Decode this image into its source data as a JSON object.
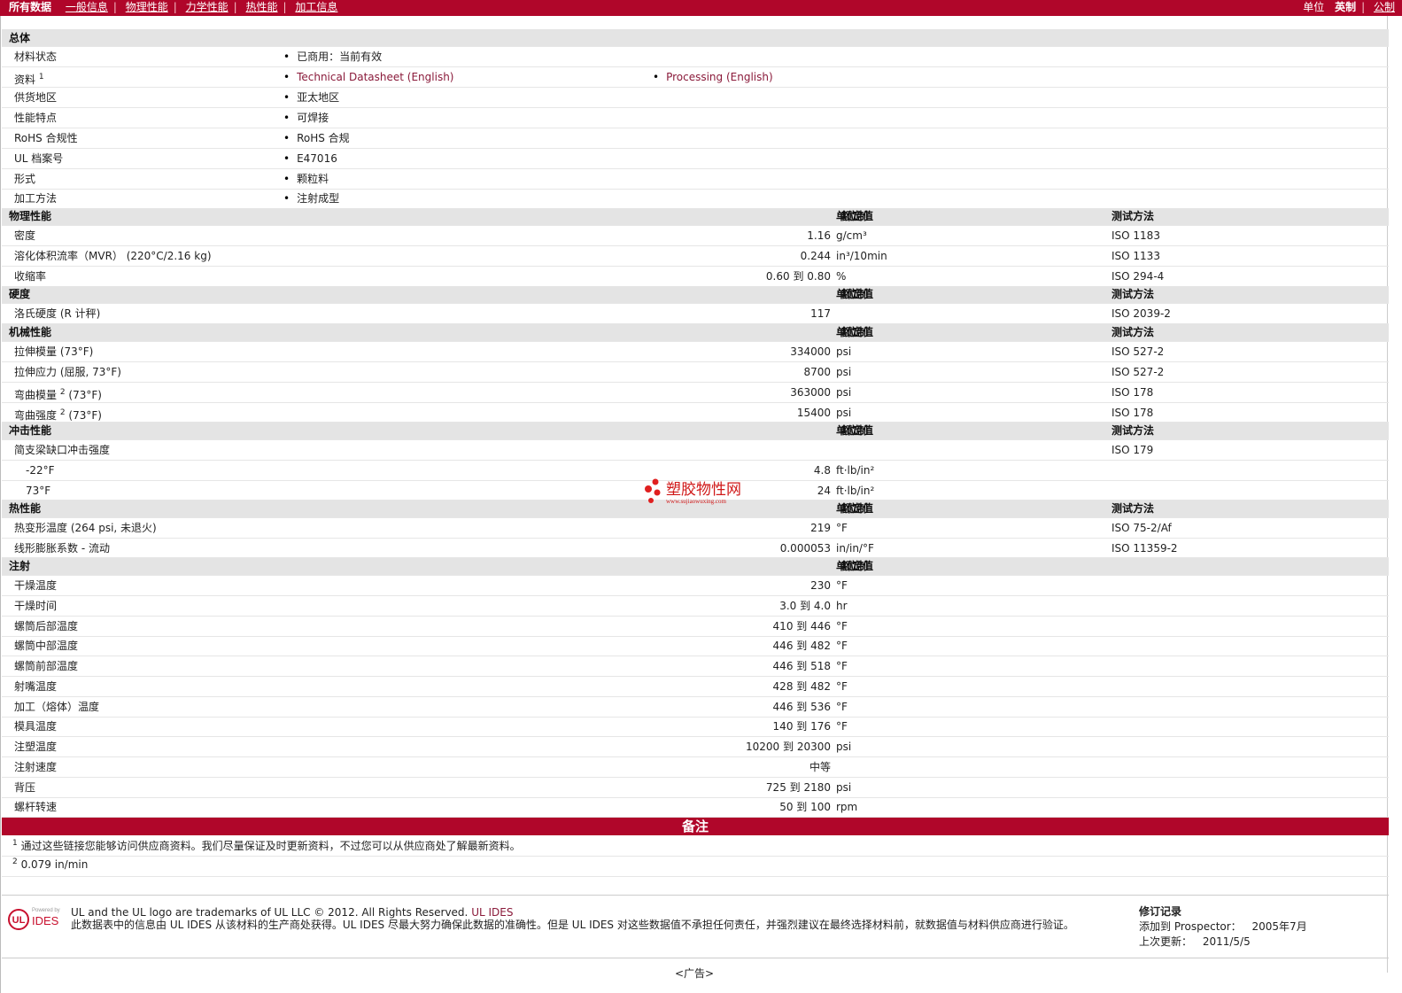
{
  "nav": {
    "all": "所有数据",
    "links": [
      "一般信息",
      "物理性能",
      "力学性能",
      "热性能",
      "加工信息"
    ],
    "unit_label": "单位",
    "unit_active": "英制",
    "unit_other": "公制"
  },
  "general": {
    "title": "总体",
    "material_status": {
      "label": "材料状态",
      "value": "已商用：当前有效"
    },
    "datasheet": {
      "label": "资料",
      "sup": "1",
      "link1": "Technical Datasheet (English)",
      "link2": "Processing (English)"
    },
    "region": {
      "label": "供货地区",
      "value": "亚太地区"
    },
    "features": {
      "label": "性能特点",
      "value": "可焊接"
    },
    "rohs": {
      "label": "RoHS 合规性",
      "value": "RoHS 合规"
    },
    "ul": {
      "label": "UL 档案号",
      "value": "E47016"
    },
    "form": {
      "label": "形式",
      "value": "颗粒料"
    },
    "method": {
      "label": "加工方法",
      "value": "注射成型"
    }
  },
  "headers": {
    "nominal": "额定值",
    "unit": "单位制",
    "test": "测试方法"
  },
  "physical": {
    "title": "物理性能",
    "rows": [
      {
        "label": "密度",
        "value": "1.16",
        "unit": "g/cm³",
        "test": "ISO 1183"
      },
      {
        "label": "溶化体积流率（MVR） (220°C/2.16 kg)",
        "value": "0.244",
        "unit": "in³/10min",
        "test": "ISO 1133"
      },
      {
        "label": "收缩率",
        "value": "0.60 到  0.80",
        "unit": "%",
        "test": "ISO 294-4"
      }
    ]
  },
  "hardness": {
    "title": "硬度",
    "rows": [
      {
        "label": "洛氏硬度 (R 计秤)",
        "value": "117",
        "unit": "",
        "test": "ISO 2039-2"
      }
    ]
  },
  "mechanical": {
    "title": "机械性能",
    "rows": [
      {
        "label": "拉伸模量 (73°F)",
        "sup": "",
        "value": "334000",
        "unit": "psi",
        "test": "ISO 527-2"
      },
      {
        "label": "拉伸应力 (屈服, 73°F)",
        "sup": "",
        "value": "8700",
        "unit": "psi",
        "test": "ISO 527-2"
      },
      {
        "label": "弯曲模量",
        "sup": "2",
        "suffix": " (73°F)",
        "value": "363000",
        "unit": "psi",
        "test": "ISO 178"
      },
      {
        "label": "弯曲强度",
        "sup": "2",
        "suffix": " (73°F)",
        "value": "15400",
        "unit": "psi",
        "test": "ISO 178"
      }
    ]
  },
  "impact": {
    "title": "冲击性能",
    "main": {
      "label": "简支梁缺口冲击强度",
      "test": "ISO 179"
    },
    "rows": [
      {
        "label": "-22°F",
        "value": "4.8",
        "unit": "ft·lb/in²"
      },
      {
        "label": "73°F",
        "value": "24",
        "unit": "ft·lb/in²"
      }
    ]
  },
  "thermal": {
    "title": "热性能",
    "rows": [
      {
        "label": "热变形温度 (264 psi, 未退火)",
        "value": "219",
        "unit": "°F",
        "test": "ISO 75-2/Af"
      },
      {
        "label": "线形膨胀系数  - 流动",
        "value": "0.000053",
        "unit": "in/in/°F",
        "test": "ISO 11359-2"
      }
    ]
  },
  "injection": {
    "title": "注射",
    "rows": [
      {
        "label": "干燥温度",
        "value": "230",
        "unit": "°F"
      },
      {
        "label": "干燥时间",
        "value": "3.0 到  4.0",
        "unit": "hr"
      },
      {
        "label": "螺筒后部温度",
        "value": "410 到  446",
        "unit": "°F"
      },
      {
        "label": "螺筒中部温度",
        "value": "446 到  482",
        "unit": "°F"
      },
      {
        "label": "螺筒前部温度",
        "value": "446 到  518",
        "unit": "°F"
      },
      {
        "label": "射嘴温度",
        "value": "428 到  482",
        "unit": "°F"
      },
      {
        "label": "加工（熔体）温度",
        "value": "446 到  536",
        "unit": "°F"
      },
      {
        "label": "模具温度",
        "value": "140 到  176",
        "unit": "°F"
      },
      {
        "label": "注塑温度",
        "value": "10200 到  20300",
        "unit": "psi"
      },
      {
        "label": "注射速度",
        "value": "中等",
        "unit": ""
      },
      {
        "label": "背压",
        "value": "725 到  2180",
        "unit": "psi"
      },
      {
        "label": "螺杆转速",
        "value": "50 到  100",
        "unit": "rpm"
      }
    ]
  },
  "notes": {
    "title": "备注",
    "fn1": {
      "sup": "1",
      "text": "通过这些链接您能够访问供应商资料。我们尽量保证及时更新资料，不过您可以从供应商处了解最新资料。"
    },
    "fn2": {
      "sup": "2",
      "text": "0.079 in/min"
    }
  },
  "footer": {
    "logo_small": "Powered by",
    "logo_ul": "UL",
    "logo_ides": "IDES",
    "line1": "UL and the UL logo are trademarks of UL LLC © 2012. All Rights Reserved.",
    "line1_link": "UL IDES",
    "line2": "此数据表中的信息由  UL IDES 从该材料的生产商处获得。UL IDES 尽最大努力确保此数据的准确性。但是  UL IDES 对这些数据值不承担任何责任，并强烈建议在最终选择材料前，就数据值与材料供应商进行验证。",
    "rev_title": "修订记录",
    "rev_added_label": "添加到  Prospector：",
    "rev_added": "2005年7月",
    "rev_updated_label": "上次更新：",
    "rev_updated": "2011/5/5"
  },
  "ad": "<广告>",
  "watermark": {
    "cn": "塑胶物性网",
    "en": "www.sujiaowuxing.com"
  }
}
